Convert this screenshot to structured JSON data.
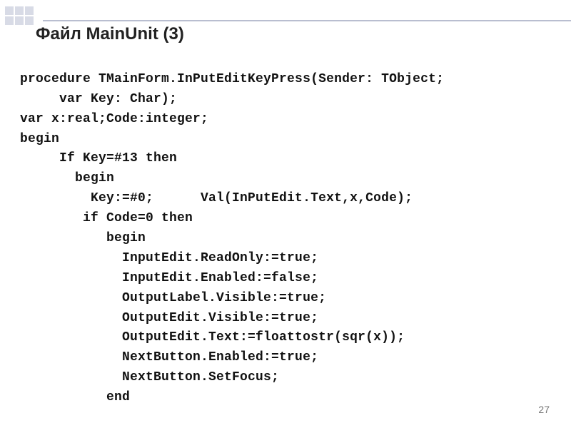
{
  "title": "Файл MainUnit (3)",
  "page_number": "27",
  "code": {
    "l1": "procedure TMainForm.InPutEditKeyPress(Sender: TObject;",
    "l2": "     var Key: Char);",
    "l3": "var x:real;Code:integer;",
    "l4": "begin",
    "l5": "     If Key=#13 then",
    "l6": "       begin",
    "l7": "         Key:=#0;      Val(InPutEdit.Text,x,Code);",
    "l8": "        if Code=0 then",
    "l9": "           begin",
    "l10": "             InputEdit.ReadOnly:=true;",
    "l11": "             InputEdit.Enabled:=false;",
    "l12": "             OutputLabel.Visible:=true;",
    "l13": "             OutputEdit.Visible:=true;",
    "l14": "             OutputEdit.Text:=floattostr(sqr(x));",
    "l15": "             NextButton.Enabled:=true;",
    "l16": "             NextButton.SetFocus;",
    "l17": "           end"
  }
}
